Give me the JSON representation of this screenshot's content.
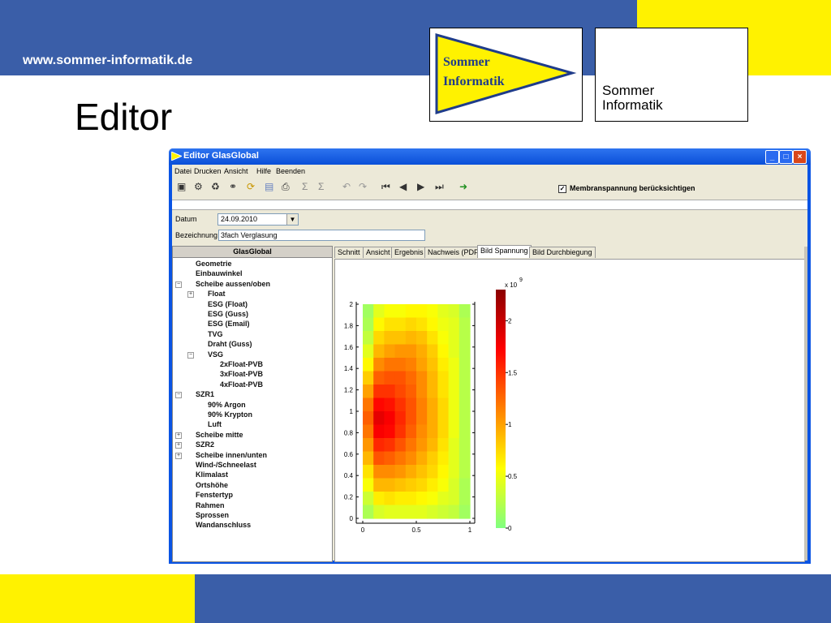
{
  "slide": {
    "url": "www.sommer-informatik.de",
    "title": "Editor",
    "logo_pennant_text": [
      "Sommer",
      "Informatik"
    ],
    "logo_box_text": "Sommer\nInformatik",
    "colors": {
      "blue": "#3a5ea8",
      "yellow": "#fff200"
    }
  },
  "window": {
    "title": "Editor GlasGlobal",
    "menu": [
      "Datei",
      "Drucken",
      "Ansicht",
      "Hilfe",
      "Beenden"
    ],
    "toolbar_icons": [
      "new-doc-icon",
      "settings-icon",
      "trash-icon",
      "binoculars-icon",
      "refresh-icon",
      "save-icon",
      "print-icon",
      "sum-icon",
      "sum-fem-icon",
      "undo-icon",
      "redo-icon",
      "first-icon",
      "prev-icon",
      "next-icon",
      "last-icon",
      "exit-icon"
    ],
    "checkbox_label": "Membranspannung berücksichtigen",
    "checkbox_checked": true,
    "datum_label": "Datum",
    "datum_value": "24.09.2010",
    "bezeichnung_label": "Bezeichnung",
    "bezeichnung_value": "3fach Verglasung"
  },
  "tree": {
    "header": "GlasGlobal",
    "items": [
      {
        "label": "Geometrie",
        "level": 0
      },
      {
        "label": "Einbauwinkel",
        "level": 0
      },
      {
        "label": "Scheibe aussen/oben",
        "level": 0,
        "expander": "−"
      },
      {
        "label": "Float",
        "level": 1,
        "expander": "+"
      },
      {
        "label": "ESG (Float)",
        "level": 1
      },
      {
        "label": "ESG (Guss)",
        "level": 1
      },
      {
        "label": "ESG (Email)",
        "level": 1
      },
      {
        "label": "TVG",
        "level": 1
      },
      {
        "label": "Draht (Guss)",
        "level": 1
      },
      {
        "label": "VSG",
        "level": 1,
        "expander": "−"
      },
      {
        "label": "2xFloat-PVB",
        "level": 2
      },
      {
        "label": "3xFloat-PVB",
        "level": 2
      },
      {
        "label": "4xFloat-PVB",
        "level": 2
      },
      {
        "label": "SZR1",
        "level": 0,
        "expander": "−"
      },
      {
        "label": "90% Argon",
        "level": 1
      },
      {
        "label": "90% Krypton",
        "level": 1
      },
      {
        "label": "Luft",
        "level": 1
      },
      {
        "label": "Scheibe mitte",
        "level": 0,
        "expander": "+"
      },
      {
        "label": "SZR2",
        "level": 0,
        "expander": "+"
      },
      {
        "label": "Scheibe innen/unten",
        "level": 0,
        "expander": "+"
      },
      {
        "label": "Wind-/Schneelast",
        "level": 0
      },
      {
        "label": "Klimalast",
        "level": 0
      },
      {
        "label": "Ortshöhe",
        "level": 0
      },
      {
        "label": "Fenstertyp",
        "level": 0
      },
      {
        "label": "Rahmen",
        "level": 0
      },
      {
        "label": "Sprossen",
        "level": 0
      },
      {
        "label": "Wandanschluss",
        "level": 0
      }
    ]
  },
  "tabs": [
    "Schnitt",
    "Ansicht",
    "Ergebnis",
    "Nachweis (PDF)",
    "Bild Spannung",
    "Bild Durchbiegung"
  ],
  "active_tab": 4,
  "chart_data": {
    "type": "heatmap",
    "x": [
      0,
      0.5,
      1
    ],
    "x_ticks": [
      "0",
      "0.5",
      "1"
    ],
    "y_ticks": [
      "0",
      "0.2",
      "0.4",
      "0.6",
      "0.8",
      "1",
      "1.2",
      "1.4",
      "1.6",
      "1.8",
      "2"
    ],
    "xlim": [
      0,
      1
    ],
    "ylim": [
      0,
      2
    ],
    "colorbar": {
      "range": [
        0,
        2.3
      ],
      "ticks": [
        "0",
        "0.5",
        "1",
        "1.5",
        "2"
      ],
      "exponent_label": "x 10",
      "exponent": "9",
      "colors": [
        "#80ff80",
        "#ffff00",
        "#ff8000",
        "#ff0000",
        "#8b0000"
      ]
    },
    "grid_cols": 10,
    "grid_rows": 16,
    "values": [
      [
        0.15,
        0.45,
        0.55,
        0.55,
        0.6,
        0.6,
        0.55,
        0.45,
        0.4,
        0.2
      ],
      [
        0.2,
        0.6,
        0.7,
        0.7,
        0.75,
        0.7,
        0.6,
        0.5,
        0.45,
        0.25
      ],
      [
        0.3,
        0.75,
        0.85,
        0.85,
        0.9,
        0.85,
        0.7,
        0.55,
        0.45,
        0.25
      ],
      [
        0.45,
        0.9,
        1.0,
        1.05,
        1.05,
        0.95,
        0.8,
        0.6,
        0.45,
        0.25
      ],
      [
        0.6,
        1.1,
        1.2,
        1.2,
        1.15,
        1.0,
        0.85,
        0.65,
        0.5,
        0.25
      ],
      [
        0.8,
        1.3,
        1.35,
        1.35,
        1.25,
        1.1,
        0.9,
        0.7,
        0.5,
        0.25
      ],
      [
        1.0,
        1.5,
        1.5,
        1.4,
        1.3,
        1.1,
        0.9,
        0.7,
        0.5,
        0.25
      ],
      [
        1.2,
        1.7,
        1.65,
        1.5,
        1.35,
        1.15,
        0.95,
        0.75,
        0.5,
        0.25
      ],
      [
        1.3,
        1.85,
        1.75,
        1.55,
        1.35,
        1.15,
        0.95,
        0.75,
        0.5,
        0.25
      ],
      [
        1.2,
        1.75,
        1.7,
        1.5,
        1.3,
        1.1,
        0.95,
        0.75,
        0.5,
        0.25
      ],
      [
        1.05,
        1.55,
        1.5,
        1.35,
        1.2,
        1.05,
        0.9,
        0.7,
        0.45,
        0.25
      ],
      [
        0.9,
        1.35,
        1.3,
        1.2,
        1.1,
        0.95,
        0.8,
        0.65,
        0.45,
        0.25
      ],
      [
        0.7,
        1.1,
        1.1,
        1.05,
        0.95,
        0.85,
        0.75,
        0.6,
        0.45,
        0.25
      ],
      [
        0.55,
        0.9,
        0.9,
        0.85,
        0.8,
        0.75,
        0.65,
        0.55,
        0.4,
        0.2
      ],
      [
        0.35,
        0.65,
        0.7,
        0.65,
        0.65,
        0.6,
        0.55,
        0.45,
        0.4,
        0.2
      ],
      [
        0.2,
        0.4,
        0.45,
        0.45,
        0.45,
        0.45,
        0.4,
        0.35,
        0.3,
        0.15
      ]
    ]
  }
}
